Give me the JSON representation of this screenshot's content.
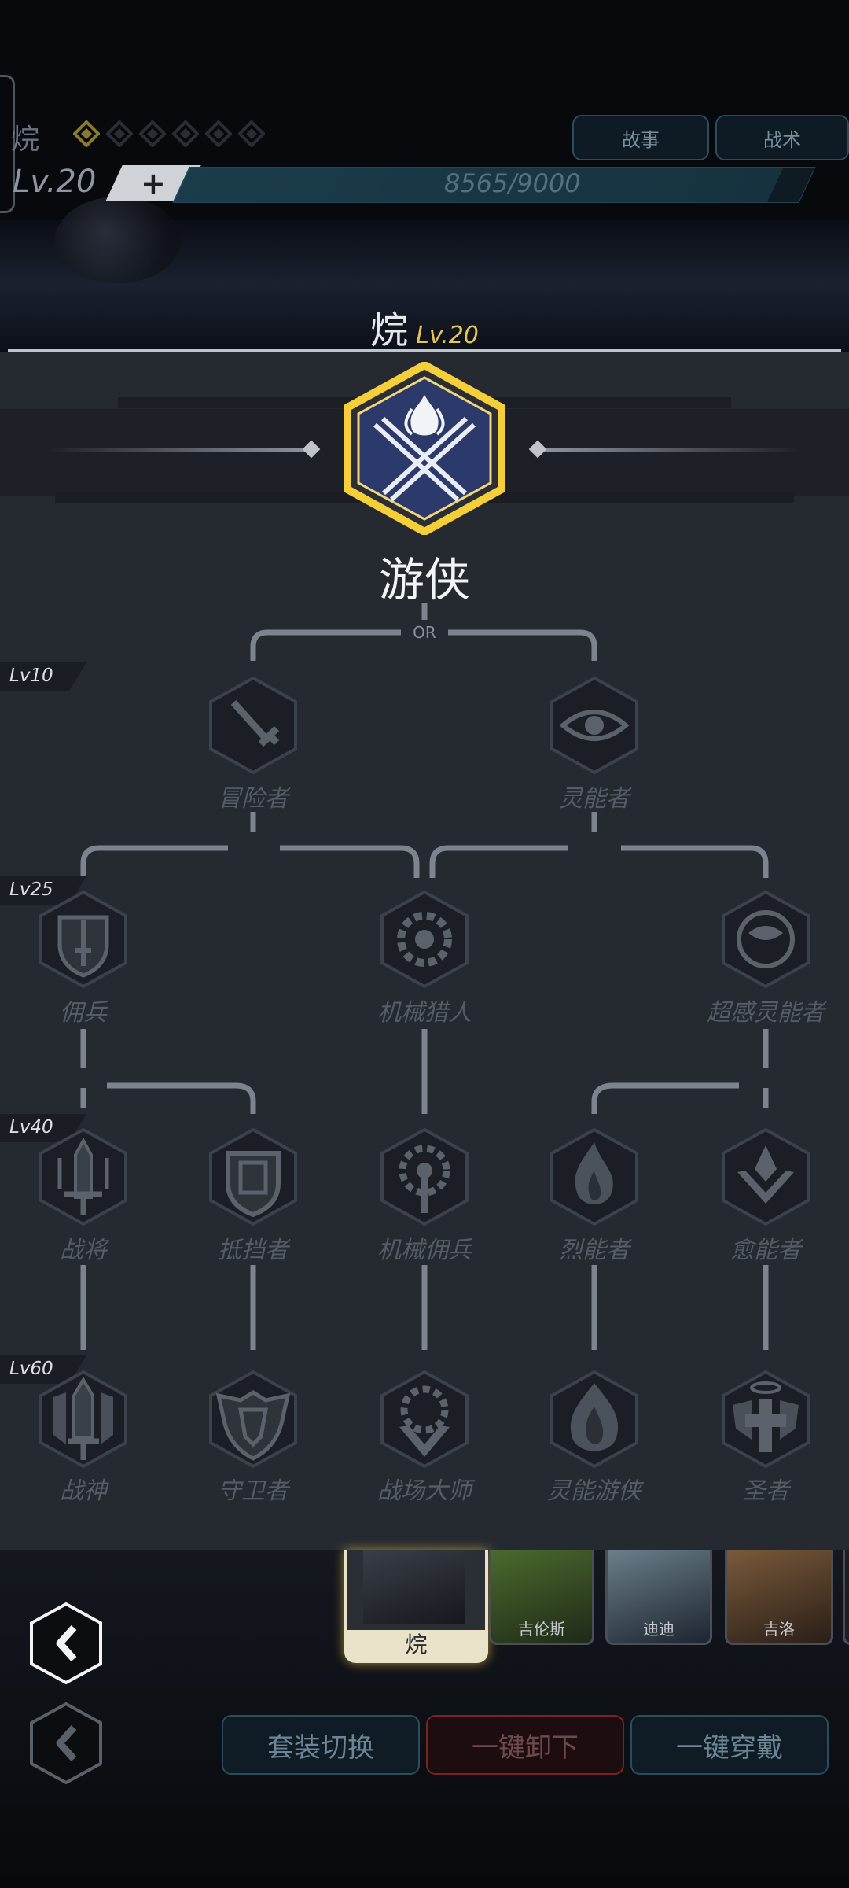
{
  "header": {
    "hero_name": "烷",
    "level": "Lv.20",
    "plus": "+",
    "exp": "8565/9000",
    "exp_progress": 0.95,
    "buttons": [
      "故事",
      "战术"
    ],
    "star_count_filled": 1,
    "star_count_total": 6
  },
  "title": {
    "name": "烷",
    "level": "Lv.20"
  },
  "current_class": {
    "name": "游侠",
    "icon": "crossed-swords-flame-icon"
  },
  "tree": {
    "or_label": "OR",
    "levels": [
      "Lv10",
      "Lv25",
      "Lv40",
      "Lv60"
    ],
    "tier1": [
      {
        "name": "冒险者",
        "icon": "sword-icon"
      },
      {
        "name": "灵能者",
        "icon": "eye-icon"
      }
    ],
    "tier2": [
      {
        "name": "佣兵",
        "icon": "shield-sword-icon"
      },
      {
        "name": "机械猎人",
        "icon": "gear-icon"
      },
      {
        "name": "超感灵能者",
        "icon": "orb-eye-icon"
      }
    ],
    "tier3": [
      {
        "name": "战将",
        "icon": "greatsword-icon"
      },
      {
        "name": "抵挡者",
        "icon": "shield-icon"
      },
      {
        "name": "机械佣兵",
        "icon": "gear-blade-icon"
      },
      {
        "name": "烈能者",
        "icon": "flame-icon"
      },
      {
        "name": "愈能者",
        "icon": "lotus-icon"
      }
    ],
    "tier4": [
      {
        "name": "战神",
        "icon": "winged-sword-icon"
      },
      {
        "name": "守卫者",
        "icon": "guardian-shield-icon"
      },
      {
        "name": "战场大师",
        "icon": "gear-crest-icon"
      },
      {
        "name": "灵能游侠",
        "icon": "psi-flame-icon"
      },
      {
        "name": "圣者",
        "icon": "holy-cross-icon"
      }
    ]
  },
  "roster": [
    {
      "name": "烷",
      "selected": true
    },
    {
      "name": "吉伦斯",
      "selected": false
    },
    {
      "name": "迪迪",
      "selected": false
    },
    {
      "name": "吉洛",
      "selected": false
    }
  ],
  "bottom_buttons": {
    "switch": "套装切换",
    "unequip": "一键卸下",
    "equip": "一键穿戴"
  },
  "colors": {
    "gold_ring": "#f5cf3a",
    "hero_hex": "#2b3a6a",
    "panel": "#252a31",
    "unequip_border": "#7a2323",
    "btn_border": "#2b4c5d"
  }
}
